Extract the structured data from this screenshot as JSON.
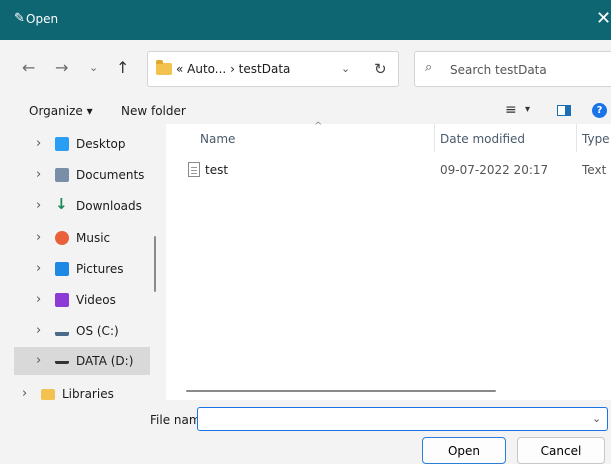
{
  "window": {
    "title": "Open",
    "close_glyph": "✕",
    "icon": "pen-icon"
  },
  "nav": {
    "back": "←",
    "forward": "→",
    "recent": "⌄",
    "up": "↑",
    "address_crumbs": "« Auto... › testData",
    "address_dropdown": "⌄",
    "refresh": "↻",
    "search_placeholder": "Search testData"
  },
  "command_bar": {
    "organize": "Organize ▾",
    "new_folder": "New folder",
    "view_icon": "≡",
    "view_dropdown": "▾",
    "help": "?"
  },
  "sidebar": {
    "items": [
      {
        "label": "Desktop",
        "icon": "desktop-icon",
        "color": "#2a9df4"
      },
      {
        "label": "Documents",
        "icon": "documents-icon",
        "color": "#7a8ea8"
      },
      {
        "label": "Downloads",
        "icon": "downloads-icon",
        "color": "#1a8a5a"
      },
      {
        "label": "Music",
        "icon": "music-icon",
        "color": "#e8613a"
      },
      {
        "label": "Pictures",
        "icon": "pictures-icon",
        "color": "#1e88e5"
      },
      {
        "label": "Videos",
        "icon": "videos-icon",
        "color": "#8e3ad6"
      },
      {
        "label": "OS (C:)",
        "icon": "drive-icon",
        "color": "#4a6a8a"
      },
      {
        "label": "DATA (D:)",
        "icon": "drive-icon",
        "color": "#333333",
        "selected": true
      },
      {
        "label": "Libraries",
        "icon": "folder-icon",
        "color": "#f2c14e"
      }
    ]
  },
  "columns": {
    "name": "Name",
    "date_modified": "Date modified",
    "type": "Type"
  },
  "files": [
    {
      "name": "test",
      "date_modified": "09-07-2022 20:17",
      "type": "Text D"
    }
  ],
  "bottom": {
    "file_name_label": "File name:",
    "file_name_value": "",
    "open_button": "Open",
    "cancel_button": "Cancel"
  }
}
